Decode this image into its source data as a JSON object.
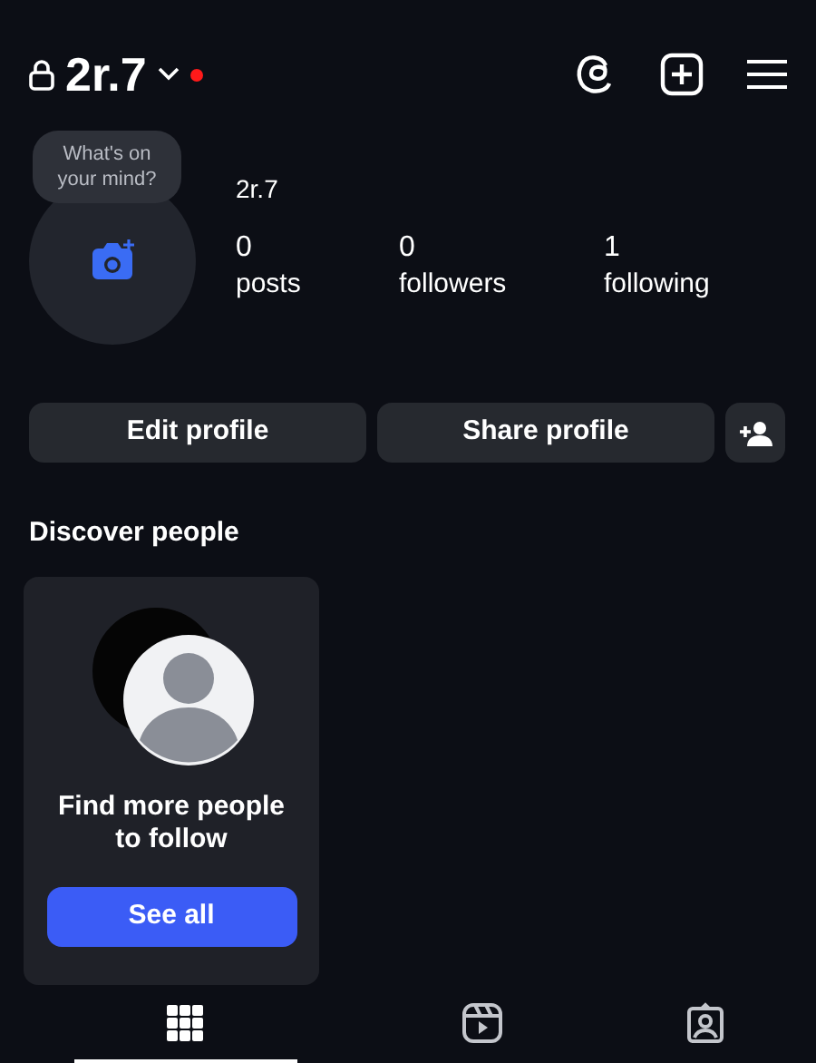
{
  "header": {
    "username": "2r.7",
    "private": true,
    "has_notification": true
  },
  "profile": {
    "note_bubble": "What's on your mind?",
    "name": "2r.7",
    "stats": [
      {
        "value": "0",
        "label": "posts"
      },
      {
        "value": "0",
        "label": "followers"
      },
      {
        "value": "1",
        "label": "following"
      }
    ]
  },
  "actions": [
    "Edit profile",
    "Share profile"
  ],
  "discover": {
    "title": "Discover people",
    "card": {
      "text": "Find more people to follow",
      "button": "See all"
    }
  },
  "tabs": [
    {
      "kind": "grid",
      "selected": true
    },
    {
      "kind": "reels",
      "selected": false
    },
    {
      "kind": "tagged",
      "selected": false
    }
  ]
}
